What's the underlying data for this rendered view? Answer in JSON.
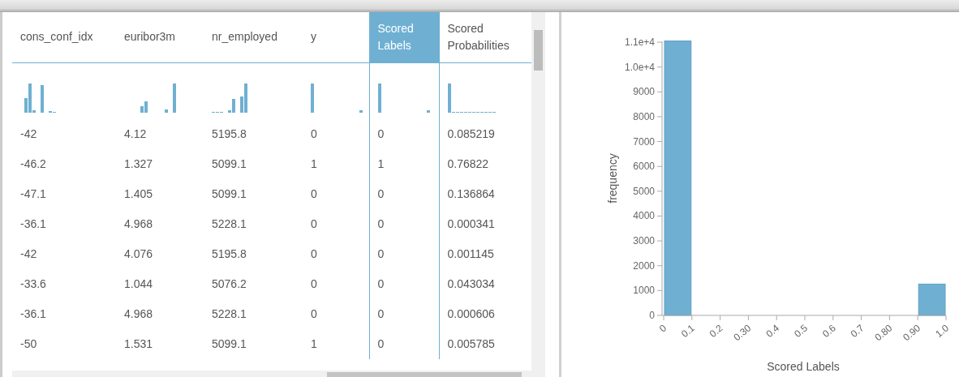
{
  "table": {
    "columns": [
      {
        "label": "cons_conf_idx",
        "selected": false
      },
      {
        "label": "euribor3m",
        "selected": false
      },
      {
        "label": "nr_employed",
        "selected": false
      },
      {
        "label": "y",
        "selected": false
      },
      {
        "label": "Scored Labels",
        "selected": true
      },
      {
        "label": "Scored Probabilities",
        "selected": false
      }
    ],
    "rows": [
      [
        "-42",
        "4.12",
        "5195.8",
        "0",
        "0",
        "0.085219"
      ],
      [
        "-46.2",
        "1.327",
        "5099.1",
        "1",
        "1",
        "0.76822"
      ],
      [
        "-47.1",
        "1.405",
        "5099.1",
        "0",
        "0",
        "0.136864"
      ],
      [
        "-36.1",
        "4.968",
        "5228.1",
        "0",
        "0",
        "0.000341"
      ],
      [
        "-42",
        "4.076",
        "5195.8",
        "0",
        "0",
        "0.001145"
      ],
      [
        "-33.6",
        "1.044",
        "5076.2",
        "0",
        "0",
        "0.043034"
      ],
      [
        "-36.1",
        "4.968",
        "5228.1",
        "0",
        "0",
        "0.000606"
      ],
      [
        "-50",
        "1.531",
        "5099.1",
        "1",
        "0",
        "0.005785"
      ]
    ]
  },
  "chart": {
    "chart_data": {
      "type": "bar",
      "xlabel": "Scored Labels",
      "ylabel": "frequency",
      "x": [
        0.05,
        0.95
      ],
      "values": [
        11050,
        1260
      ],
      "xlim": [
        0,
        1
      ],
      "ylim": [
        0,
        11100
      ],
      "xticks": [
        {
          "value": 0,
          "label": "0"
        },
        {
          "value": 0.1,
          "label": "0.1"
        },
        {
          "value": 0.2,
          "label": "0.2"
        },
        {
          "value": 0.3,
          "label": "0.30"
        },
        {
          "value": 0.4,
          "label": "0.4"
        },
        {
          "value": 0.5,
          "label": "0.5"
        },
        {
          "value": 0.6,
          "label": "0.6"
        },
        {
          "value": 0.7,
          "label": "0.7"
        },
        {
          "value": 0.8,
          "label": "0.80"
        },
        {
          "value": 0.9,
          "label": "0.90"
        },
        {
          "value": 1,
          "label": "1.0"
        }
      ],
      "yticks": [
        0,
        1000,
        2000,
        3000,
        4000,
        5000,
        6000,
        7000,
        8000,
        9000,
        {
          "value": 10000,
          "label": "1.0e+4"
        },
        {
          "value": 11000,
          "label": "1.1e+4"
        }
      ],
      "color": "#6fb0d2"
    }
  }
}
